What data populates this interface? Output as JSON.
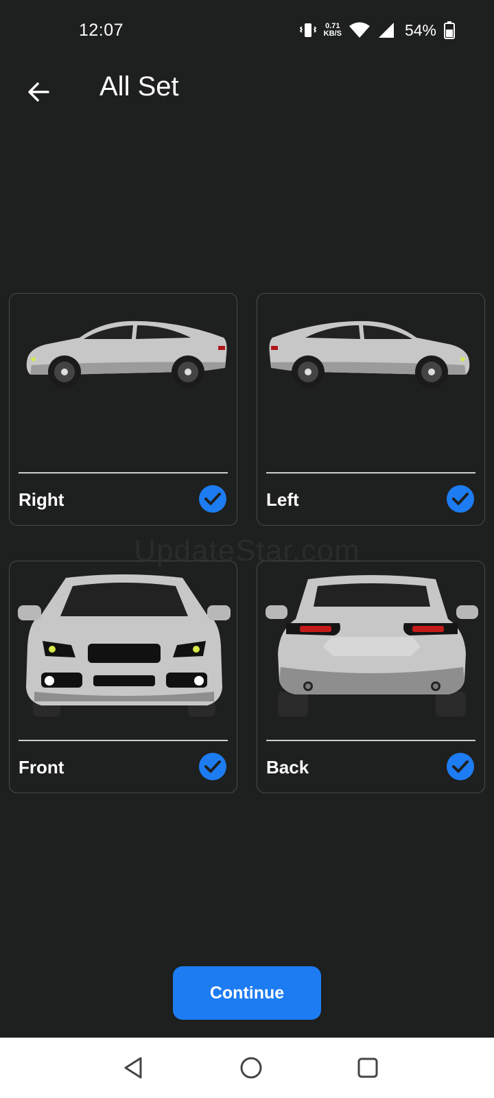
{
  "status_bar": {
    "time": "12:07",
    "net_speed_value": "0.71",
    "net_speed_unit": "KB/S",
    "battery_percent": "54%",
    "icons": [
      "vibrate-icon",
      "wifi-icon",
      "signal-icon",
      "battery-icon"
    ]
  },
  "header": {
    "title": "All Set",
    "back_icon": "arrow-left-icon"
  },
  "cards": [
    {
      "label": "Right",
      "checked": true,
      "image": "car-right-side-view"
    },
    {
      "label": "Left",
      "checked": true,
      "image": "car-left-side-view"
    },
    {
      "label": "Front",
      "checked": true,
      "image": "car-front-view"
    },
    {
      "label": "Back",
      "checked": true,
      "image": "car-back-view"
    }
  ],
  "watermark": "UpdateStar.com",
  "primary_button": {
    "label": "Continue"
  },
  "nav_bar": {
    "icons": [
      "nav-back-icon",
      "nav-home-icon",
      "nav-recents-icon"
    ]
  },
  "colors": {
    "background": "#1e1f1f",
    "accent": "#1d7cf2",
    "card_border": "#4a4b4c",
    "car_body": "#c8c7c8"
  }
}
